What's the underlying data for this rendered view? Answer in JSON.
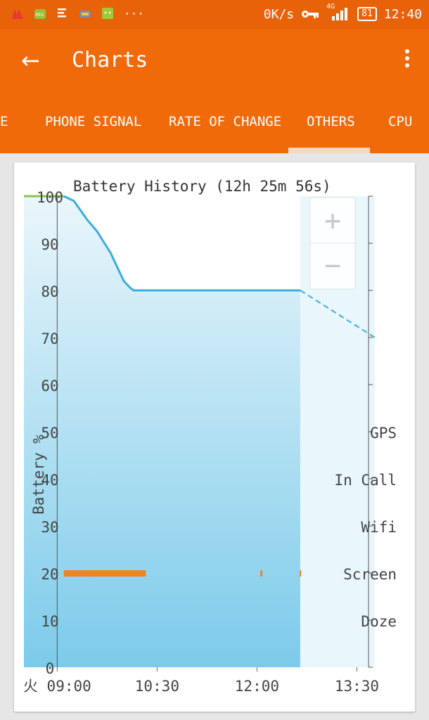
{
  "status_bar": {
    "net_speed": "0K/s",
    "network": "4G",
    "battery_level": "81",
    "time": "12:40",
    "overflow": "···"
  },
  "app_bar": {
    "title": "Charts"
  },
  "tabs": [
    {
      "label": "E",
      "selected": false
    },
    {
      "label": "PHONE SIGNAL",
      "selected": false
    },
    {
      "label": "RATE OF CHANGE",
      "selected": false
    },
    {
      "label": "OTHERS",
      "selected": true
    },
    {
      "label": "CPU",
      "selected": false
    }
  ],
  "zoom": {
    "in": "+",
    "out": "−"
  },
  "colors": {
    "accent": "#f06a0a",
    "line": "#3aaedb",
    "charge": "#8bc34a",
    "screen_bar": "#f58220"
  },
  "chart_data": {
    "type": "area",
    "title": "Battery History (12h 25m 56s)",
    "ylabel": "Battery %",
    "ylim": [
      0,
      100
    ],
    "y_ticks": [
      "0",
      "10",
      "20",
      "30",
      "40",
      "50",
      "60",
      "70",
      "80",
      "90",
      "100"
    ],
    "x_ticks": [
      {
        "label": "火 09:00",
        "t": 9.0
      },
      {
        "label": "10:30",
        "t": 10.5
      },
      {
        "label": "12:00",
        "t": 12.0
      },
      {
        "label": "13:30",
        "t": 13.5
      }
    ],
    "x_range": [
      8.5,
      13.77
    ],
    "series": [
      {
        "role": "charging",
        "points": [
          [
            8.5,
            100
          ],
          [
            9.1,
            100
          ]
        ]
      },
      {
        "role": "discharging",
        "points": [
          [
            9.1,
            100
          ],
          [
            9.25,
            99
          ],
          [
            9.45,
            95
          ],
          [
            9.6,
            92.5
          ],
          [
            9.8,
            88
          ],
          [
            10.0,
            82
          ],
          [
            10.1,
            80.5
          ],
          [
            10.15,
            80
          ],
          [
            12.65,
            80
          ]
        ]
      },
      {
        "role": "prediction",
        "points": [
          [
            12.65,
            80
          ],
          [
            13.77,
            70
          ]
        ]
      }
    ],
    "prediction_start": 12.65,
    "state_labels": [
      "GPS",
      "In Call",
      "Wifi",
      "Screen",
      "Doze"
    ],
    "screen_segments": [
      [
        9.1,
        10.33
      ],
      [
        12.05,
        12.08
      ],
      [
        12.64,
        12.66
      ]
    ]
  }
}
